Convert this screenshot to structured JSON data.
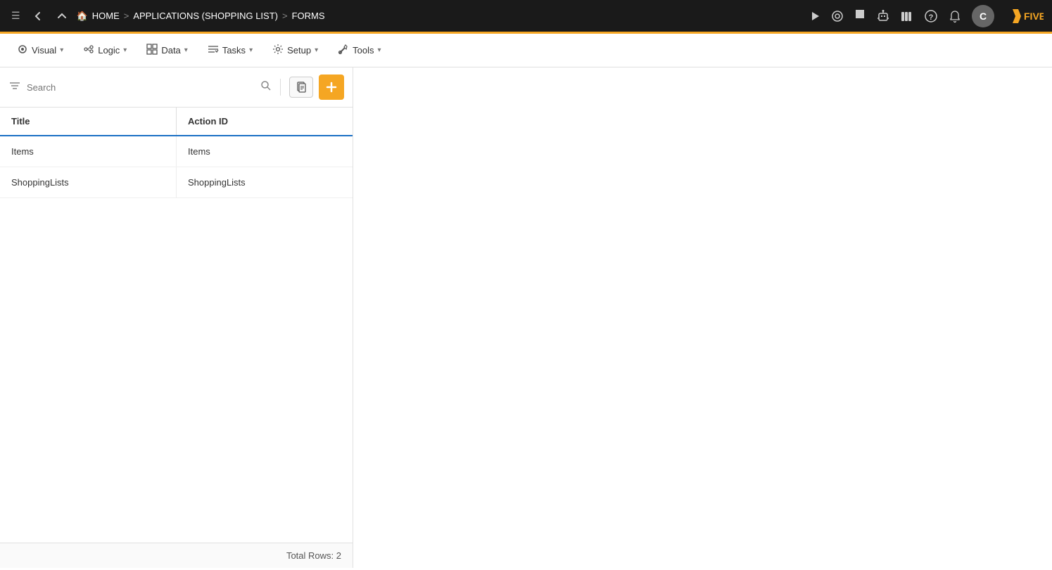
{
  "topNav": {
    "menuIcon": "☰",
    "backIcon": "←",
    "upIcon": "↑",
    "homeLabel": "HOME",
    "sep1": ">",
    "appLabel": "APPLICATIONS (SHOPPING LIST)",
    "sep2": ">",
    "formsLabel": "FORMS",
    "playIcon": "▶",
    "searchIcon": "⊙",
    "stopIcon": "■",
    "robotIcon": "🤖",
    "booksIcon": "📚",
    "helpIcon": "?",
    "bellIcon": "🔔",
    "avatarLabel": "C",
    "fiveBrand": "FIVE"
  },
  "menuBar": {
    "items": [
      {
        "icon": "👁",
        "label": "Visual",
        "id": "visual"
      },
      {
        "icon": "⚙",
        "label": "Logic",
        "id": "logic"
      },
      {
        "icon": "⊞",
        "label": "Data",
        "id": "data"
      },
      {
        "icon": "☰",
        "label": "Tasks",
        "id": "tasks"
      },
      {
        "icon": "⚙",
        "label": "Setup",
        "id": "setup"
      },
      {
        "icon": "🔧",
        "label": "Tools",
        "id": "tools"
      }
    ]
  },
  "search": {
    "placeholder": "Search",
    "filterIcon": "≡",
    "searchIcon": "🔍",
    "docIcon": "📄",
    "addIcon": "+"
  },
  "table": {
    "columns": [
      {
        "id": "title",
        "label": "Title"
      },
      {
        "id": "actionId",
        "label": "Action ID"
      }
    ],
    "rows": [
      {
        "title": "Items",
        "actionId": "Items"
      },
      {
        "title": "ShoppingLists",
        "actionId": "ShoppingLists"
      }
    ],
    "footer": "Total Rows: 2"
  }
}
